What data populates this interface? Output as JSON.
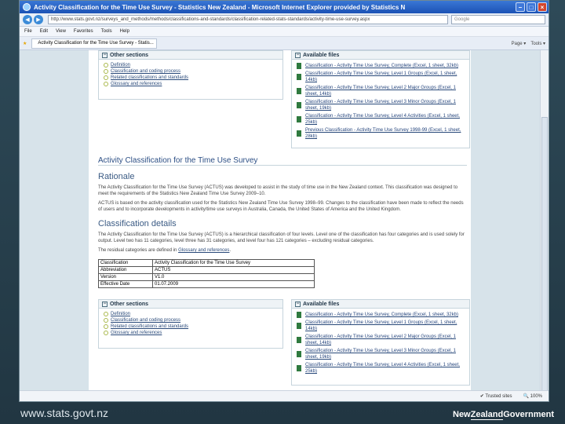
{
  "window": {
    "title": "Activity Classification for the Time Use Survey - Statistics New Zealand - Microsoft Internet Explorer provided by Statistics N"
  },
  "address": {
    "url": "http://www.stats.govt.nz/surveys_and_methods/methods/classifications-and-standards/classification-related-stats-standards/activity-time-use-survey.aspx",
    "search_placeholder": "Google"
  },
  "menu": [
    "File",
    "Edit",
    "View",
    "Favorites",
    "Tools",
    "Help"
  ],
  "tab": {
    "label": "Activity Classification for the Time Use Survey - Statis..."
  },
  "toolbar_right": [
    "Page ▾",
    "Tools ▾"
  ],
  "other_sections": {
    "title": "Other sections",
    "links": [
      "Definition",
      "Classification and coding process",
      "Related classifications and standards",
      "Glossary and references"
    ]
  },
  "available_files": {
    "title": "Available files",
    "files": [
      "Classification - Activity Time Use Survey, Complete (Excel, 1 sheet, 32kb)",
      "Classification - Activity Time Use Survey, Level 1 Groups (Excel, 1 sheet, 14kb)",
      "Classification - Activity Time Use Survey, Level 2 Major Groups (Excel, 1 sheet, 14kb)",
      "Classification - Activity Time Use Survey, Level 3 Minor Groups (Excel, 1 sheet, 19kb)",
      "Classification - Activity Time Use Survey, Level 4 Activities (Excel, 1 sheet, 25kb)",
      "Previous Classification - Activity Time Use Survey 1998-99 (Excel, 1 sheet, 28kb)"
    ]
  },
  "available_files_bottom": {
    "files": [
      "Classification - Activity Time Use Survey, Complete (Excel, 1 sheet, 32kb)",
      "Classification - Activity Time Use Survey, Level 1 Groups (Excel, 1 sheet, 14kb)",
      "Classification - Activity Time Use Survey, Level 2 Major Groups (Excel, 1 sheet, 14kb)",
      "Classification - Activity Time Use Survey, Level 3 Minor Groups (Excel, 1 sheet, 19kb)",
      "Classification - Activity Time Use Survey, Level 4 Activities (Excel, 1 sheet, 25kb)"
    ]
  },
  "main": {
    "page_title": "Activity Classification for the Time Use Survey",
    "rationale_heading": "Rationale",
    "rationale_p1": "The Activity Classification for the Time Use Survey (ACTUS) was developed to assist in the study of time use in the New Zealand context. This classification was designed to meet the requirements of the Statistics New Zealand Time Use Survey 2009–10.",
    "rationale_p2": "ACTUS is based on the activity classification used for the Statistics New Zealand Time Use Survey 1998–99. Changes to the classification have been made to reflect the needs of users and to incorporate developments in activity/time use surveys in Australia, Canada, the United States of America and the United Kingdom.",
    "details_heading": "Classification details",
    "details_p1": "The Activity Classification for the Time Use Survey (ACTUS) is a hierarchical classification of four levels. Level one of the classification has four categories and is used solely for output. Level two has 11 categories, level three has 31 categories, and level four has 121 categories – excluding residual categories.",
    "details_p2_before": "The residual categories are defined in ",
    "details_p2_link": "Glossary and references",
    "details_p2_after": "."
  },
  "details_table": [
    {
      "k": "Classification",
      "v": "Activity Classification for the Time Use Survey"
    },
    {
      "k": "Abbreviation",
      "v": "ACTUS"
    },
    {
      "k": "Version",
      "v": "V1.0"
    },
    {
      "k": "Effective Date",
      "v": "01.07.2009"
    }
  ],
  "status": {
    "zone": "Trusted sites",
    "zoom": "100%"
  },
  "branding": {
    "left": "www.stats.govt.nz",
    "right_prefix": "New",
    "right_underline": "Zealand",
    "right_suffix": "Government"
  }
}
